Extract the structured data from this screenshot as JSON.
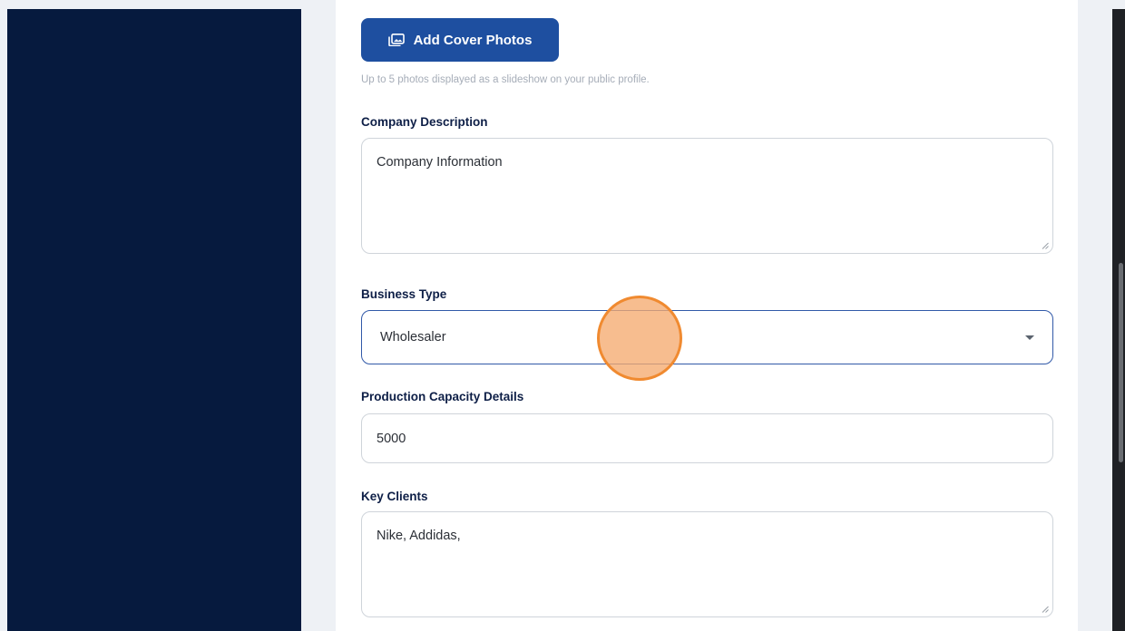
{
  "cover_photos": {
    "button_label": "Add Cover Photos",
    "helper_text": "Up to 5 photos displayed as a slideshow on your public profile."
  },
  "company_description": {
    "label": "Company Description",
    "value": "Company Information"
  },
  "business_type": {
    "label": "Business Type",
    "selected": "Wholesaler"
  },
  "production_capacity": {
    "label": "Production Capacity Details",
    "value": "5000"
  },
  "key_clients": {
    "label": "Key Clients",
    "value": "Nike, Addidas,"
  },
  "colors": {
    "sidebar": "#061a3e",
    "primary_button": "#1e4fa0",
    "label_text": "#0e1f47",
    "focus_border": "#3159a8",
    "click_marker": "#f08a30"
  },
  "icons": {
    "cover_button": "image-gallery-icon",
    "select_caret": "chevron-down-icon",
    "textarea_grip": "resize-grip-icon"
  }
}
